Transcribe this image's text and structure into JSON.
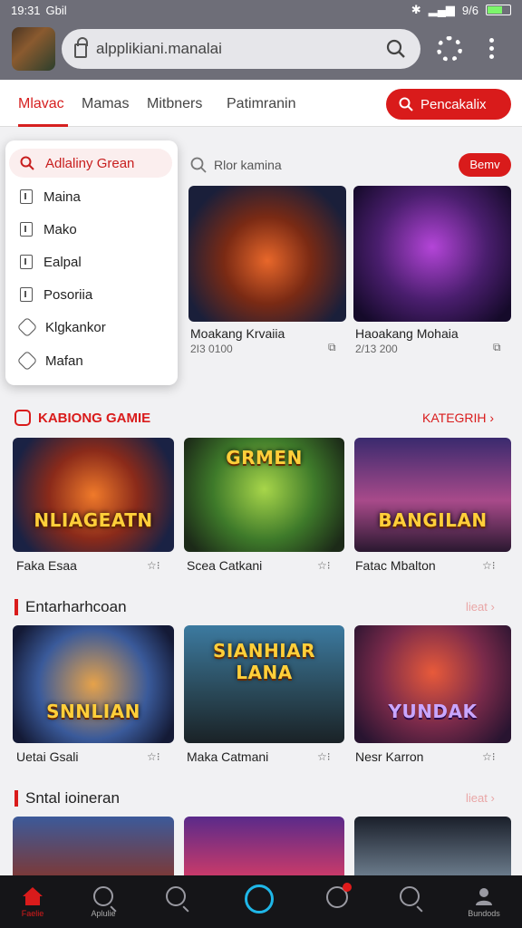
{
  "status": {
    "time": "19:31",
    "left_extra": "Gbil",
    "battery": "9/6"
  },
  "browser": {
    "url": "alpplikiani.manalai"
  },
  "tabs": [
    {
      "label": "Mlavac"
    },
    {
      "label": "Mamas"
    },
    {
      "label": "Mitbners"
    },
    {
      "label": "Patimranin"
    }
  ],
  "search_pill": "Pencakalix",
  "menu": [
    {
      "label": "Adlaliny Grean",
      "icon": "search-icon"
    },
    {
      "label": "Maina",
      "icon": "box-icon"
    },
    {
      "label": "Mako",
      "icon": "box-icon"
    },
    {
      "label": "Ealpal",
      "icon": "box-icon"
    },
    {
      "label": "Posoriia",
      "icon": "box-icon"
    },
    {
      "label": "Klgkankor",
      "icon": "hexagon-icon"
    },
    {
      "label": "Mafan",
      "icon": "hexagon-icon"
    }
  ],
  "mini_search": {
    "placeholder": "Rlor kamina",
    "button": "Bemv"
  },
  "top_cards": [
    {
      "title": "Moakang Krvaiia",
      "sub": "2I3 0100"
    },
    {
      "title": "Haoakang Mohaia",
      "sub": "2/13 200"
    }
  ],
  "sections": [
    {
      "title": "KABIONG GAMIE",
      "link": "KATEGRIH",
      "cards": [
        {
          "title": "Faka Esaa",
          "logo": "NLIAGEATN"
        },
        {
          "title": "Scea Catkani",
          "logo": "GRMEN"
        },
        {
          "title": "Fatac Mbalton",
          "logo": "BANGILAN"
        }
      ]
    },
    {
      "title": "Entarharhcoan",
      "link": "lieat",
      "cards": [
        {
          "title": "Uetai Gsali",
          "logo": "SNNLIAN"
        },
        {
          "title": "Maka Catmani",
          "logo": "SIANHIAR LANA"
        },
        {
          "title": "Nesr Karron",
          "logo": "YUNDAK"
        }
      ]
    },
    {
      "title": "Sntal ioineran",
      "link": "lieat"
    }
  ],
  "bottom_nav": [
    {
      "label": "Faelie"
    },
    {
      "label": "Aplulie"
    },
    {
      "label": ""
    },
    {
      "label": ""
    },
    {
      "label": ""
    },
    {
      "label": ""
    },
    {
      "label": "Bundods"
    }
  ],
  "colors": {
    "accent": "#d91b1b",
    "nav_bg": "#151518",
    "chrome": "#6e6e78"
  }
}
